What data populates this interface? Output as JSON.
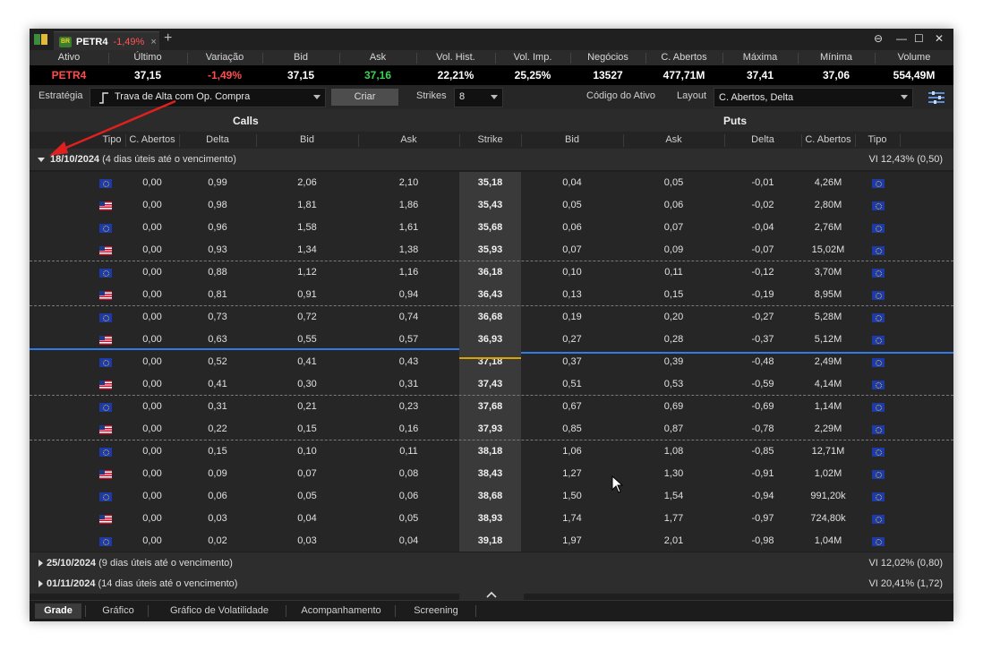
{
  "tab": {
    "ticker": "PETR4",
    "variation": "-1,49%",
    "close": "×",
    "add": "+"
  },
  "window_controls": {
    "more": "⊖",
    "minimize": "—",
    "maximize": "☐",
    "close": "✕"
  },
  "quote": {
    "headers": [
      "Ativo",
      "Último",
      "Variação",
      "Bid",
      "Ask",
      "Vol. Hist.",
      "Vol. Imp.",
      "Negócios",
      "C. Abertos",
      "Máxima",
      "Mínima",
      "Volume"
    ],
    "values": [
      "PETR4",
      "37,15",
      "-1,49%",
      "37,15",
      "37,16",
      "22,21%",
      "25,25%",
      "13527",
      "477,71M",
      "37,41",
      "37,06",
      "554,49M"
    ],
    "colors": {
      "ticker": "#ff4d4d",
      "variation": "#ff4d4d",
      "ask": "#39d353"
    }
  },
  "toolbar": {
    "strategy_label": "Estratégia",
    "strategy_value": "Trava de Alta com Op. Compra",
    "create_button": "Criar",
    "strikes_label": "Strikes",
    "strikes_value": "8",
    "asset_code_label": "Código do Ativo",
    "layout_label": "Layout",
    "layout_value": "C. Abertos, Delta"
  },
  "sections": {
    "calls": "Calls",
    "puts": "Puts"
  },
  "columns": [
    "Tipo",
    "C. Abertos",
    "Delta",
    "Bid",
    "Ask",
    "Strike",
    "Bid",
    "Ask",
    "Delta",
    "C. Abertos",
    "Tipo"
  ],
  "expirations": [
    {
      "date": "18/10/2024",
      "desc": "(4 dias úteis até o vencimento)",
      "vi": "VI 12,43% (0,50)"
    },
    {
      "date": "25/10/2024",
      "desc": "(9 dias úteis até o vencimento)",
      "vi": "VI 12,02% (0,80)"
    },
    {
      "date": "01/11/2024",
      "desc": "(14 dias úteis até o vencimento)",
      "vi": "VI 20,41% (1,72)"
    }
  ],
  "rows": [
    {
      "ctype": "eu",
      "c_open": "0,00",
      "c_delta": "0,99",
      "c_bid": "2,06",
      "c_ask": "2,10",
      "strike": "35,18",
      "p_bid": "0,04",
      "p_ask": "0,05",
      "p_delta": "-0,01",
      "p_open": "4,26M",
      "ptype": "eu"
    },
    {
      "ctype": "us",
      "c_open": "0,00",
      "c_delta": "0,98",
      "c_bid": "1,81",
      "c_ask": "1,86",
      "strike": "35,43",
      "p_bid": "0,05",
      "p_ask": "0,06",
      "p_delta": "-0,02",
      "p_open": "2,80M",
      "ptype": "eu"
    },
    {
      "ctype": "eu",
      "c_open": "0,00",
      "c_delta": "0,96",
      "c_bid": "1,58",
      "c_ask": "1,61",
      "strike": "35,68",
      "p_bid": "0,06",
      "p_ask": "0,07",
      "p_delta": "-0,04",
      "p_open": "2,76M",
      "ptype": "eu"
    },
    {
      "ctype": "us",
      "c_open": "0,00",
      "c_delta": "0,93",
      "c_bid": "1,34",
      "c_ask": "1,38",
      "strike": "35,93",
      "p_bid": "0,07",
      "p_ask": "0,09",
      "p_delta": "-0,07",
      "p_open": "15,02M",
      "ptype": "eu"
    },
    {
      "ctype": "eu",
      "c_open": "0,00",
      "c_delta": "0,88",
      "c_bid": "1,12",
      "c_ask": "1,16",
      "strike": "36,18",
      "p_bid": "0,10",
      "p_ask": "0,11",
      "p_delta": "-0,12",
      "p_open": "3,70M",
      "ptype": "eu"
    },
    {
      "ctype": "us",
      "c_open": "0,00",
      "c_delta": "0,81",
      "c_bid": "0,91",
      "c_ask": "0,94",
      "strike": "36,43",
      "p_bid": "0,13",
      "p_ask": "0,15",
      "p_delta": "-0,19",
      "p_open": "8,95M",
      "ptype": "eu"
    },
    {
      "ctype": "eu",
      "c_open": "0,00",
      "c_delta": "0,73",
      "c_bid": "0,72",
      "c_ask": "0,74",
      "strike": "36,68",
      "p_bid": "0,19",
      "p_ask": "0,20",
      "p_delta": "-0,27",
      "p_open": "5,28M",
      "ptype": "eu"
    },
    {
      "ctype": "us",
      "c_open": "0,00",
      "c_delta": "0,63",
      "c_bid": "0,55",
      "c_ask": "0,57",
      "strike": "36,93",
      "p_bid": "0,27",
      "p_ask": "0,28",
      "p_delta": "-0,37",
      "p_open": "5,12M",
      "ptype": "eu"
    },
    {
      "ctype": "eu",
      "c_open": "0,00",
      "c_delta": "0,52",
      "c_bid": "0,41",
      "c_ask": "0,43",
      "strike": "37,18",
      "p_bid": "0,37",
      "p_ask": "0,39",
      "p_delta": "-0,48",
      "p_open": "2,49M",
      "ptype": "eu"
    },
    {
      "ctype": "us",
      "c_open": "0,00",
      "c_delta": "0,41",
      "c_bid": "0,30",
      "c_ask": "0,31",
      "strike": "37,43",
      "p_bid": "0,51",
      "p_ask": "0,53",
      "p_delta": "-0,59",
      "p_open": "4,14M",
      "ptype": "eu"
    },
    {
      "ctype": "eu",
      "c_open": "0,00",
      "c_delta": "0,31",
      "c_bid": "0,21",
      "c_ask": "0,23",
      "strike": "37,68",
      "p_bid": "0,67",
      "p_ask": "0,69",
      "p_delta": "-0,69",
      "p_open": "1,14M",
      "ptype": "eu"
    },
    {
      "ctype": "us",
      "c_open": "0,00",
      "c_delta": "0,22",
      "c_bid": "0,15",
      "c_ask": "0,16",
      "strike": "37,93",
      "p_bid": "0,85",
      "p_ask": "0,87",
      "p_delta": "-0,78",
      "p_open": "2,29M",
      "ptype": "eu"
    },
    {
      "ctype": "eu",
      "c_open": "0,00",
      "c_delta": "0,15",
      "c_bid": "0,10",
      "c_ask": "0,11",
      "strike": "38,18",
      "p_bid": "1,06",
      "p_ask": "1,08",
      "p_delta": "-0,85",
      "p_open": "12,71M",
      "ptype": "eu"
    },
    {
      "ctype": "us",
      "c_open": "0,00",
      "c_delta": "0,09",
      "c_bid": "0,07",
      "c_ask": "0,08",
      "strike": "38,43",
      "p_bid": "1,27",
      "p_ask": "1,30",
      "p_delta": "-0,91",
      "p_open": "1,02M",
      "ptype": "eu"
    },
    {
      "ctype": "eu",
      "c_open": "0,00",
      "c_delta": "0,06",
      "c_bid": "0,05",
      "c_ask": "0,06",
      "strike": "38,68",
      "p_bid": "1,50",
      "p_ask": "1,54",
      "p_delta": "-0,94",
      "p_open": "991,20k",
      "ptype": "eu"
    },
    {
      "ctype": "us",
      "c_open": "0,00",
      "c_delta": "0,03",
      "c_bid": "0,04",
      "c_ask": "0,05",
      "strike": "38,93",
      "p_bid": "1,74",
      "p_ask": "1,77",
      "p_delta": "-0,97",
      "p_open": "724,80k",
      "ptype": "eu"
    },
    {
      "ctype": "eu",
      "c_open": "0,00",
      "c_delta": "0,02",
      "c_bid": "0,03",
      "c_ask": "0,04",
      "strike": "39,18",
      "p_bid": "1,97",
      "p_ask": "2,01",
      "p_delta": "-0,98",
      "p_open": "1,04M",
      "ptype": "eu"
    }
  ],
  "bottom_tabs": [
    "Grade",
    "Gráfico",
    "Gráfico de Volatilidade",
    "Acompanhamento",
    "Screening"
  ],
  "accent_colors": {
    "atm_line": "#2f7be8",
    "atm_strike": "#d9a400",
    "annotation_arrow": "#e02020"
  }
}
